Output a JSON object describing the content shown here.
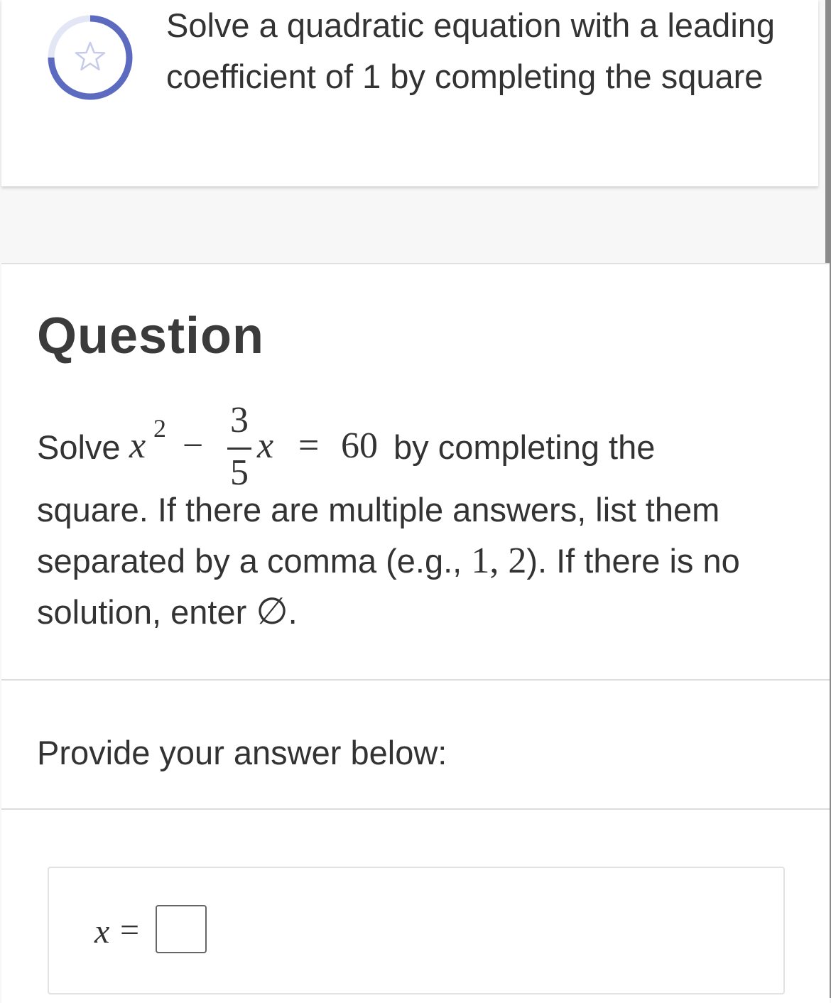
{
  "skill": {
    "title": "Solve a quadratic equation with a leading coefficient of 1 by completing the square",
    "progress_icon": "star-icon",
    "accent_color": "#5c6bc0"
  },
  "question": {
    "heading": "Question",
    "solve_word": "Solve",
    "eq_x": "x",
    "eq_exp": "2",
    "eq_minus": "−",
    "frac_num": "3",
    "frac_den": "5",
    "eq_x2": "x",
    "eq_equals": "=",
    "eq_rhs": "60",
    "after_eq": "by completing the",
    "line2": "square. If there are multiple answers, list them",
    "line3_pre": "separated by a comma (e.g., ",
    "line3_example": "1, 2",
    "line3_post": "). If there is no",
    "line4_pre": "solution, enter ",
    "empty_set": "∅",
    "line4_post": "."
  },
  "answer": {
    "prompt": "Provide your answer below:",
    "var_label": "x",
    "equals": "=",
    "value": ""
  }
}
